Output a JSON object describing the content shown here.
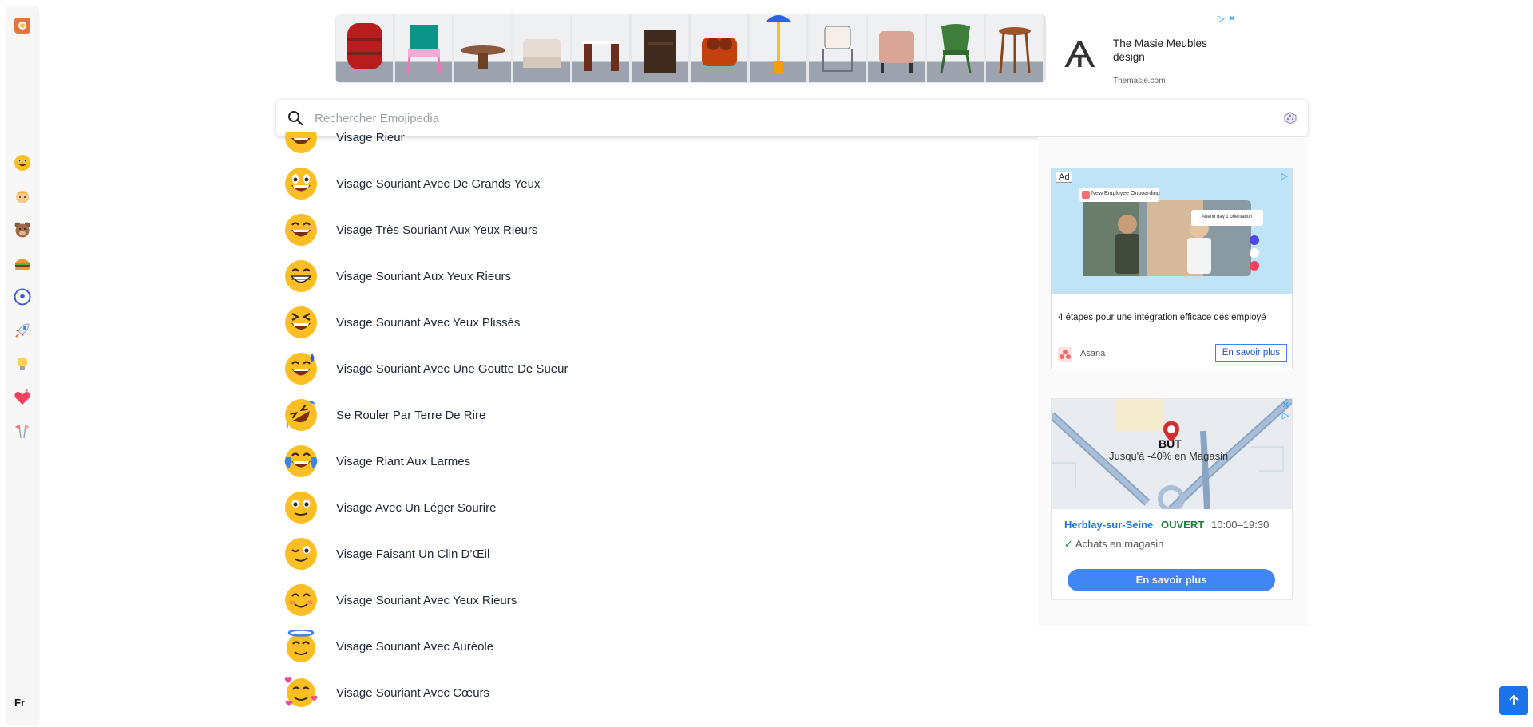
{
  "rail": {
    "categories": [
      {
        "name": "smileys",
        "icon": "grinning-face-icon"
      },
      {
        "name": "people",
        "icon": "person-icon"
      },
      {
        "name": "animals",
        "icon": "bear-icon"
      },
      {
        "name": "food",
        "icon": "burger-icon"
      },
      {
        "name": "activities",
        "icon": "soccer-ball-icon"
      },
      {
        "name": "travel",
        "icon": "rocket-icon"
      },
      {
        "name": "objects",
        "icon": "light-bulb-icon"
      },
      {
        "name": "symbols",
        "icon": "heart-icon"
      },
      {
        "name": "flags",
        "icon": "flags-icon"
      }
    ],
    "language": "Fr"
  },
  "top_ad": {
    "brand_title": "The Masie Meubles design",
    "brand_url": "Themasie.com",
    "brand_logo": "Ѧ"
  },
  "search": {
    "placeholder": "Rechercher Emojipedia"
  },
  "emoji_list": [
    "Visage Rieur",
    "Visage Souriant Avec De Grands Yeux",
    "Visage Très Souriant Aux Yeux Rieurs",
    "Visage Souriant Aux Yeux Rieurs",
    "Visage Souriant Avec Yeux Plissés",
    "Visage Souriant Avec Une Goutte De Sueur",
    "Se Rouler Par Terre De Rire",
    "Visage Riant Aux Larmes",
    "Visage Avec Un Léger Sourire",
    "Visage Faisant Un Clin D’Œil",
    "Visage Souriant Avec Yeux Rieurs",
    "Visage Souriant Avec Auréole",
    "Visage Souriant Avec Cœurs"
  ],
  "ad1": {
    "badge": "Ad",
    "text": "4 étapes pour une intégration efficace des employé",
    "brand": "Asana",
    "cta": "En savoir plus",
    "card1": "New Employee Onboarding",
    "card2": "Attend day 1 orientation"
  },
  "ad2": {
    "brand": "BUT",
    "promo": "Jusqu'à -40% en Magasin",
    "location": "Herblay-sur-Seine",
    "status": "OUVERT",
    "hours": "10:00–19:30",
    "shop": "Achats en magasin",
    "cta": "En savoir plus"
  },
  "colors": {
    "accent": "#1a73e8",
    "emoji_yellow": "#fbbf24"
  }
}
